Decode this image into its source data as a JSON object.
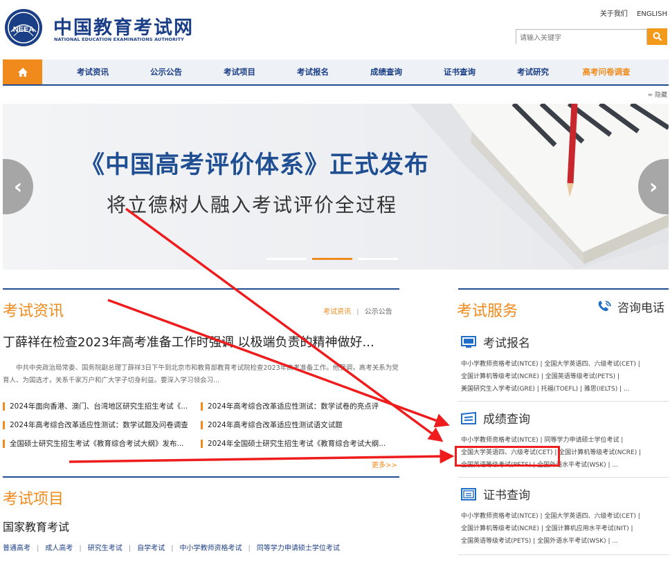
{
  "header": {
    "logo_cn": "中国教育考试网",
    "logo_en": "NATIONAL EDUCATION EXAMINATIONS AUTHORITY",
    "logo_badge": "NEEA",
    "top_links": [
      "关于我们",
      "ENGLISH"
    ],
    "search_placeholder": "请输入关键字"
  },
  "nav": {
    "items": [
      "考试资讯",
      "公示公告",
      "考试项目",
      "考试报名",
      "成绩查询",
      "证书查询",
      "考试研究",
      "高考问卷调查"
    ],
    "hide_label": "≈ 隐藏"
  },
  "banner": {
    "title": "《中国高考评价体系》正式发布",
    "subtitle": "将立德树人融入考试评价全过程",
    "prev": "‹",
    "next": "›",
    "active_slide": 2,
    "slide_count": 3
  },
  "news": {
    "title": "考试资讯",
    "tab_active": "考试资讯",
    "tab_sep": "|",
    "tab_other": "公示公告",
    "headline": "丁薛祥在检查2023年高考准备工作时强调 以极端负责的精神做好...",
    "summary": "中共中央政治局常委、国务院副总理丁薛祥3日下午到北京市和教育部教育考试院检查2023年高考准备工作。他强调，高考关系为党育人、为国选才，关系千家万户和广大学子切身利益。要深入学习领会习...",
    "items": [
      "2024年面向香港、澳门、台湾地区研究生招生考试《...",
      "2024年高考综合改革适应性测试：数学试卷的亮点评",
      "2024年高考综合改革适应性测试：数学试题及问卷调查",
      "2024年高考综合改革适应性测试语文试题",
      "全国硕士研究生招生考试《教育综合考试大纲》发布...",
      "2024年全国硕士研究生招生考试《教育综合考试大纲..."
    ],
    "more": "更多>>"
  },
  "projects": {
    "title": "考试项目",
    "category": "国家教育考试",
    "links": [
      "普通高考",
      "成人高考",
      "研究生考试",
      "自学考试",
      "中小学教师资格考试",
      "同等学力申请硕士学位考试"
    ],
    "sep": "|"
  },
  "services": {
    "title": "考试服务",
    "hotline": "咨询电话",
    "blocks": [
      {
        "name": "考试报名",
        "lines": [
          "中小学教师资格考试(NTCE) | 全国大学英语四、六级考试(CET) |",
          "全国计算机等级考试(NCRE) | 全国英语等级考试(PETS) |",
          "美国研究生入学考试(GRE) | 托福(TOEFL) | 雅思(IELTS) | ..."
        ]
      },
      {
        "name": "成绩查询",
        "lines": [
          "中小学教师资格考试(NTCE) | 同等学力申请硕士学位考试 |",
          "全国大学英语四、六级考试(CET) | 全国计算机等级考试(NCRE) |",
          "全国英语等级考试(PETS) | 全国外语水平考试(WSK) | ..."
        ]
      },
      {
        "name": "证书查询",
        "lines": [
          "中小学教师资格考试(NTCE) | 全国大学英语四、六级考试(CET) |",
          "全国计算机等级考试(NCRE) | 全国计算机应用水平考试(NIT) |",
          "全国英语等级考试(PETS) | 全国外语水平考试(WSK) | ..."
        ]
      }
    ]
  },
  "colors": {
    "brand_blue": "#1b3f86",
    "accent_orange": "#f08a1c",
    "annotation_red": "#ee1c1c"
  }
}
